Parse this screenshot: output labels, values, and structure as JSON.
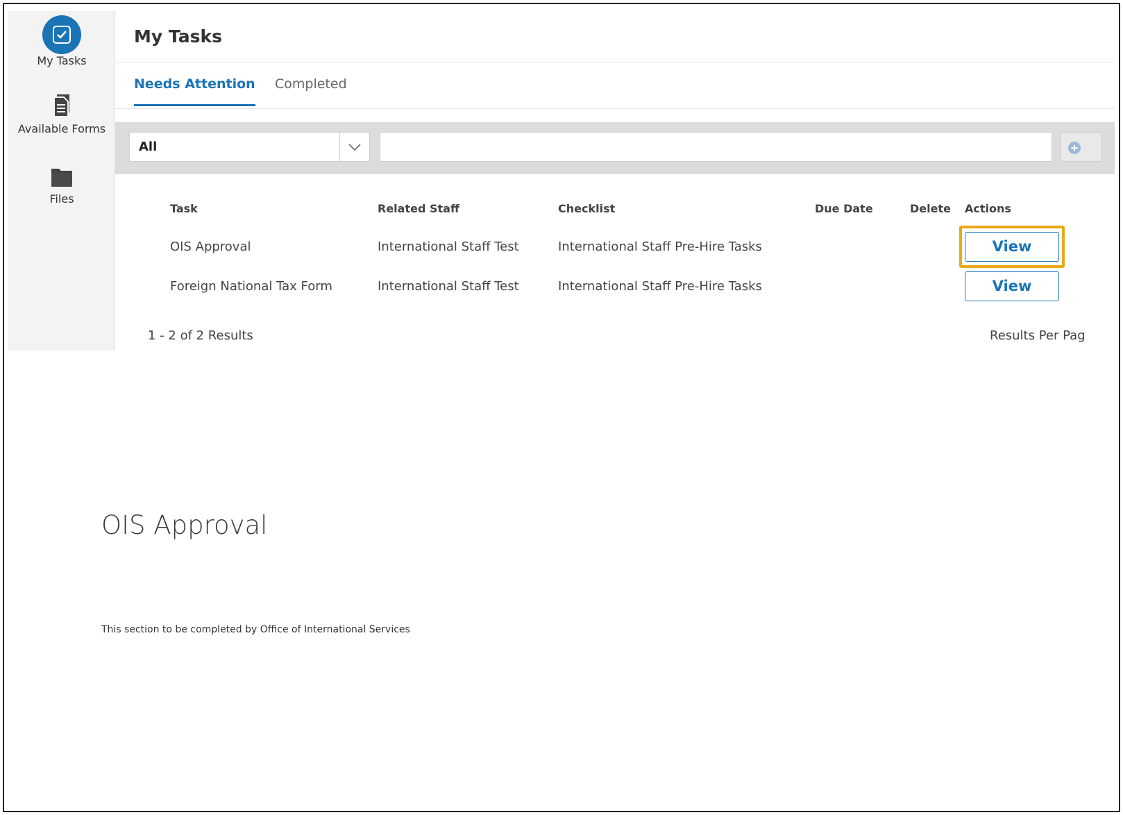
{
  "sidebar": {
    "items": [
      {
        "label": "My Tasks",
        "icon": "checkbox-icon"
      },
      {
        "label": "Available Forms",
        "icon": "document-icon"
      },
      {
        "label": "Files",
        "icon": "folder-icon"
      }
    ]
  },
  "header": {
    "title": "My Tasks"
  },
  "tabs": [
    {
      "label": "Needs Attention",
      "active": true
    },
    {
      "label": "Completed",
      "active": false
    }
  ],
  "filter": {
    "select_value": "All",
    "search_value": "",
    "search_placeholder": ""
  },
  "table": {
    "columns": [
      "Task",
      "Related Staff",
      "Checklist",
      "Due Date",
      "Delete",
      "Actions"
    ],
    "rows": [
      {
        "task": "OIS Approval",
        "staff": "International Staff Test",
        "checklist": "International Staff Pre-Hire Tasks",
        "due": "",
        "action": "View"
      },
      {
        "task": "Foreign National Tax Form",
        "staff": "International Staff Test",
        "checklist": "International Staff Pre-Hire Tasks",
        "due": "",
        "action": "View"
      }
    ],
    "results_count": "1 - 2 of 2 Results",
    "results_per_page_label": "Results Per Pag"
  },
  "document": {
    "title": "OIS Approval",
    "note": "This section to be completed by Office of International Services"
  },
  "colors": {
    "accent": "#1b74b6",
    "highlight": "#e9a918",
    "sidebar_bg": "#f3f3f3",
    "filter_bg": "#dcdcdc"
  }
}
